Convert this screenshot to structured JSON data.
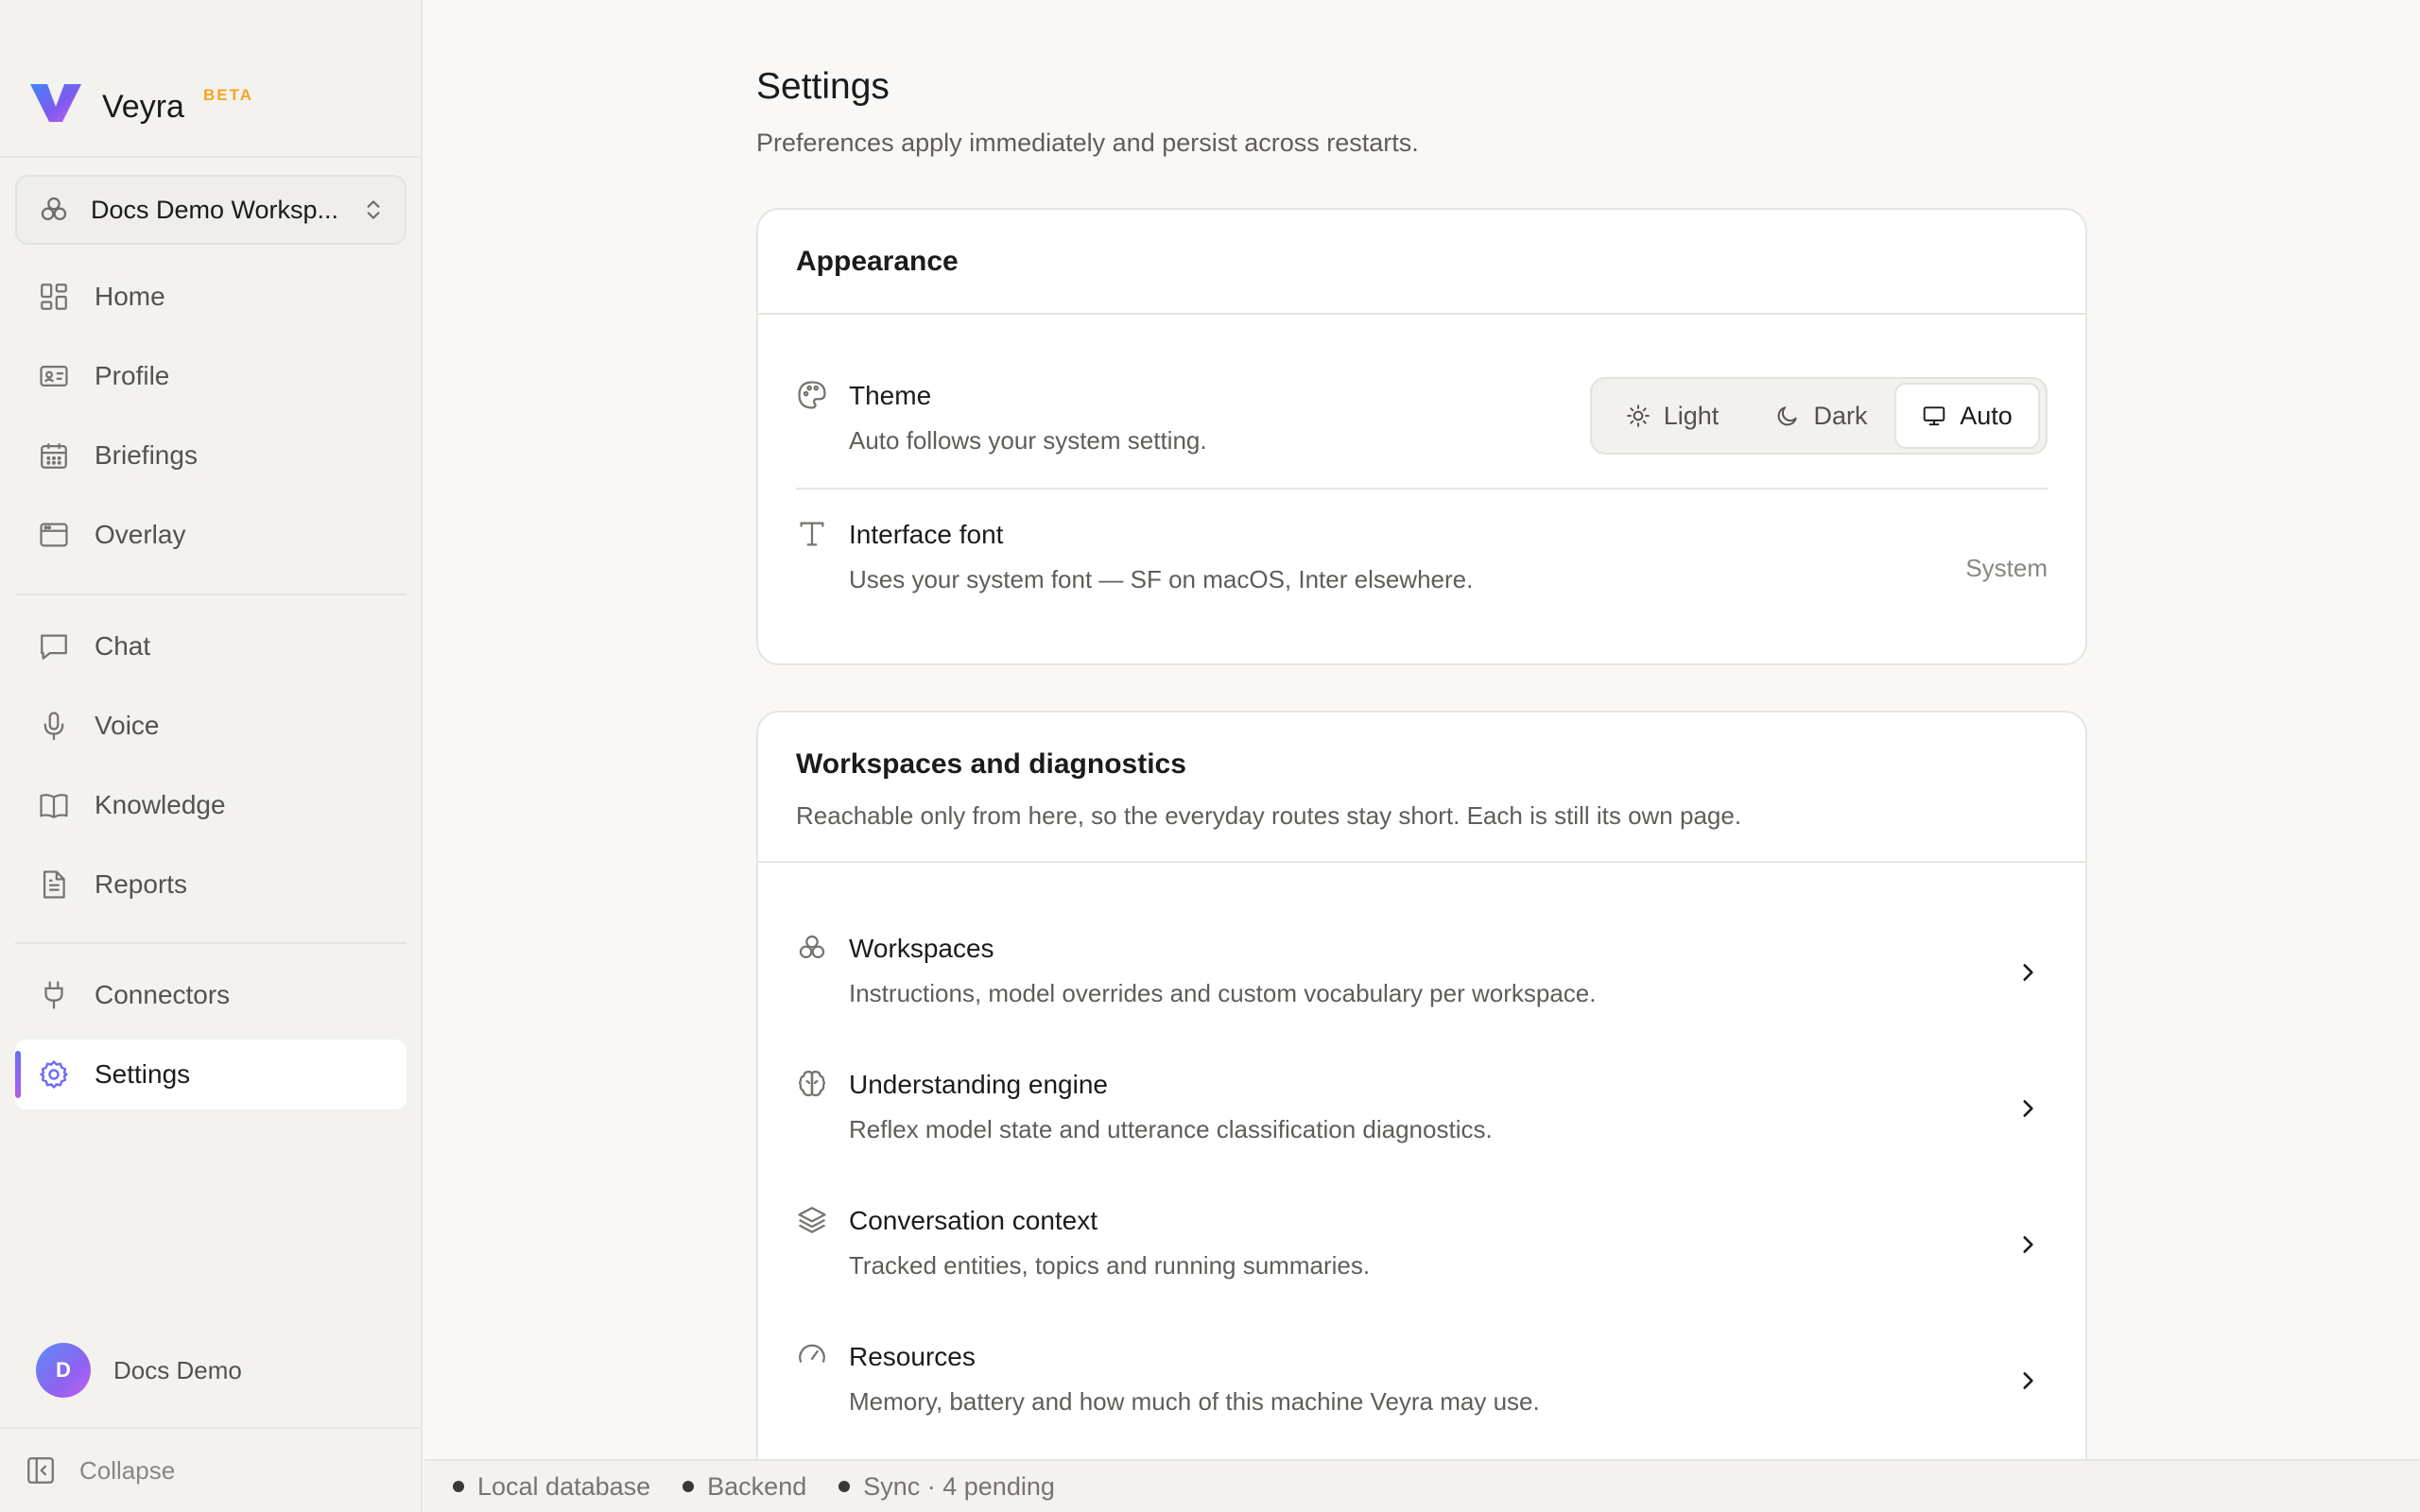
{
  "app": {
    "name": "Veyra",
    "badge": "BETA",
    "accent_gradient": [
      "#3f86f6",
      "#7c5cf0",
      "#b45cf0"
    ]
  },
  "sidebar": {
    "workspace": {
      "name": "Docs Demo Worksp...",
      "icon": "workspaces-icon"
    },
    "groups": [
      [
        {
          "label": "Home",
          "icon": "home-grid-icon"
        },
        {
          "label": "Profile",
          "icon": "id-card-icon"
        },
        {
          "label": "Briefings",
          "icon": "calendar-icon"
        },
        {
          "label": "Overlay",
          "icon": "window-icon"
        }
      ],
      [
        {
          "label": "Chat",
          "icon": "chat-bubble-icon"
        },
        {
          "label": "Voice",
          "icon": "microphone-icon"
        },
        {
          "label": "Knowledge",
          "icon": "book-icon"
        },
        {
          "label": "Reports",
          "icon": "document-icon"
        }
      ],
      [
        {
          "label": "Connectors",
          "icon": "plug-icon"
        },
        {
          "label": "Settings",
          "icon": "gear-icon",
          "active": true
        }
      ]
    ],
    "user": {
      "initial": "D",
      "name": "Docs Demo"
    },
    "collapse_label": "Collapse"
  },
  "main": {
    "title": "Settings",
    "subtitle": "Preferences apply immediately and persist across restarts.",
    "appearance": {
      "title": "Appearance",
      "theme": {
        "title": "Theme",
        "desc": "Auto follows your system setting.",
        "icon": "palette-icon",
        "options": [
          "Light",
          "Dark",
          "Auto"
        ],
        "selected": "Auto"
      },
      "font": {
        "title": "Interface font",
        "desc": "Uses your system font — SF on macOS, Inter elsewhere.",
        "value": "System",
        "icon": "type-icon"
      }
    },
    "workspaces": {
      "title": "Workspaces and diagnostics",
      "desc": "Reachable only from here, so the everyday routes stay short. Each is still its own page.",
      "items": [
        {
          "title": "Workspaces",
          "desc": "Instructions, model overrides and custom vocabulary per workspace.",
          "icon": "workspaces-icon"
        },
        {
          "title": "Understanding engine",
          "desc": "Reflex model state and utterance classification diagnostics.",
          "icon": "brain-icon"
        },
        {
          "title": "Conversation context",
          "desc": "Tracked entities, topics and running summaries.",
          "icon": "layers-icon"
        },
        {
          "title": "Resources",
          "desc": "Memory, battery and how much of this machine Veyra may use.",
          "icon": "gauge-icon"
        }
      ]
    }
  },
  "statusbar": {
    "items": [
      "Local database",
      "Backend",
      "Sync · 4 pending"
    ]
  }
}
